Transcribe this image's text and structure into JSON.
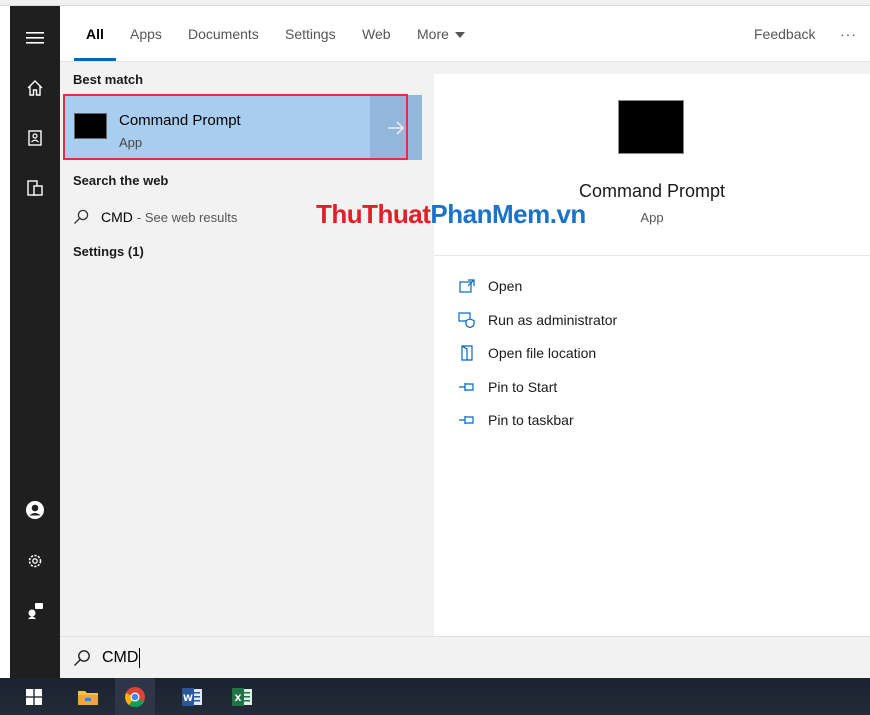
{
  "tabs": {
    "all": "All",
    "apps": "Apps",
    "documents": "Documents",
    "settings": "Settings",
    "web": "Web",
    "more": "More",
    "feedback": "Feedback",
    "overflow": "···"
  },
  "results": {
    "best_match_heading": "Best match",
    "best_match": {
      "title": "Command Prompt",
      "subtitle": "App"
    },
    "search_web_heading": "Search the web",
    "web_query": "CMD",
    "web_suffix": "- See web results",
    "settings_heading": "Settings (1)"
  },
  "watermark": {
    "part1": "ThuThuat",
    "part2": "PhanMem",
    "part3": ".vn"
  },
  "preview": {
    "title": "Command Prompt",
    "subtitle": "App",
    "actions": [
      {
        "label": "Open",
        "icon": "open-icon"
      },
      {
        "label": "Run as administrator",
        "icon": "shield-icon"
      },
      {
        "label": "Open file location",
        "icon": "folder-icon"
      },
      {
        "label": "Pin to Start",
        "icon": "pin-icon"
      },
      {
        "label": "Pin to taskbar",
        "icon": "pin-icon"
      }
    ]
  },
  "searchbox": {
    "value": "CMD"
  },
  "colors": {
    "selection": "#a9cdef",
    "highlight_border": "#e0303a",
    "accent": "#0067c0",
    "rail": "#1f1f1f"
  }
}
